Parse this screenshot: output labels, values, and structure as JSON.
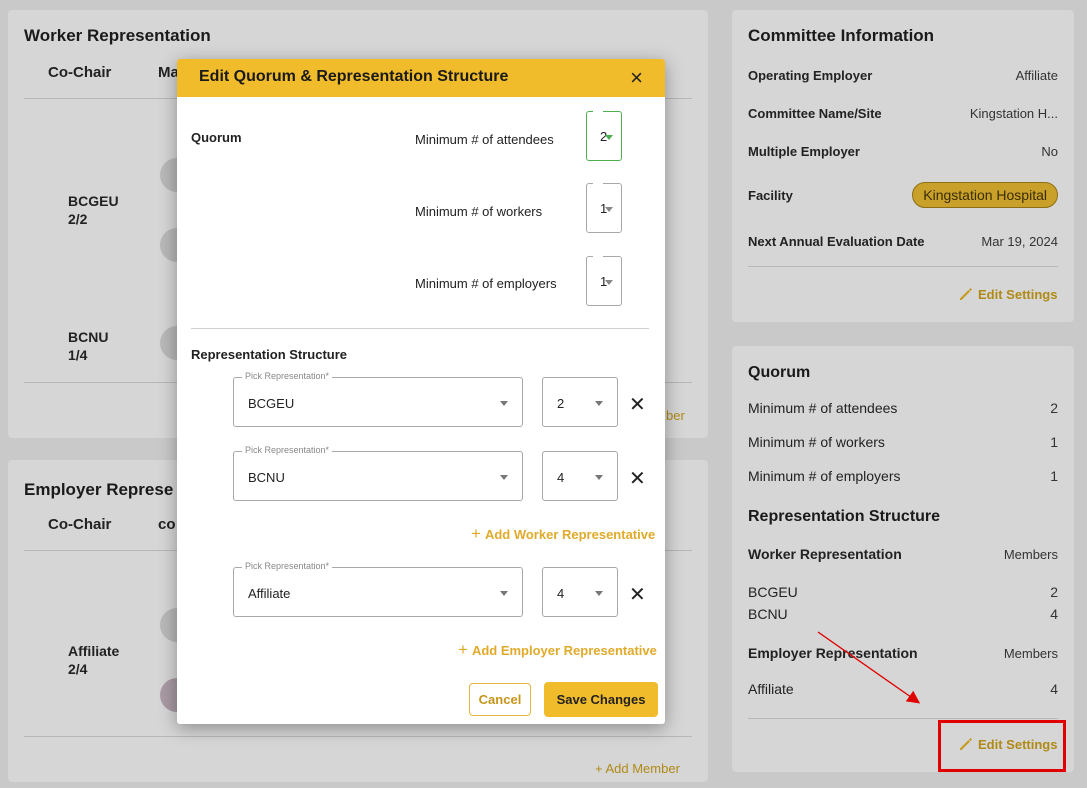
{
  "worker_card": {
    "title": "Worker Representation",
    "col_cochair": "Co-Chair",
    "col_members_partial": "Ma",
    "reps": [
      {
        "name": "BCGEU",
        "count": "2/2"
      },
      {
        "name": "BCNU",
        "count": "1/4"
      }
    ],
    "add_member_partial": "ber"
  },
  "employer_card": {
    "title": "Employer Represe",
    "col_cochair": "Co-Chair",
    "col_members_partial": "co",
    "reps": [
      {
        "name": "Affiliate",
        "count": "2/4"
      }
    ],
    "add_member": "+ Add Member"
  },
  "committee": {
    "title": "Committee Information",
    "rows": [
      {
        "key": "Operating Employer",
        "value": "Affiliate"
      },
      {
        "key": "Committee Name/Site",
        "value": "Kingstation H..."
      },
      {
        "key": "Multiple Employer",
        "value": "No"
      },
      {
        "key": "Facility",
        "value": "Kingstation Hospital"
      },
      {
        "key": "Next Annual Evaluation Date",
        "value": "Mar 19, 2024"
      }
    ],
    "edit_label": "Edit Settings"
  },
  "quorum_card": {
    "title": "Quorum",
    "rows": [
      {
        "key": "Minimum # of attendees",
        "value": "2"
      },
      {
        "key": "Minimum # of workers",
        "value": "1"
      },
      {
        "key": "Minimum # of employers",
        "value": "1"
      }
    ],
    "rep_structure_title": "Representation Structure",
    "worker_header": {
      "key": "Worker Representation",
      "value": "Members"
    },
    "worker_rows": [
      {
        "key": "BCGEU",
        "value": "2"
      },
      {
        "key": "BCNU",
        "value": "4"
      }
    ],
    "employer_header": {
      "key": "Employer Representation",
      "value": "Members"
    },
    "employer_rows": [
      {
        "key": "Affiliate",
        "value": "4"
      }
    ],
    "edit_label": "Edit Settings"
  },
  "modal": {
    "title": "Edit Quorum & Representation Structure",
    "close_icon": "×",
    "quorum_label": "Quorum",
    "min_attendees_label": "Minimum # of attendees",
    "min_attendees_value": "2",
    "min_workers_label": "Minimum # of workers",
    "min_workers_value": "1",
    "min_employers_label": "Minimum # of employers",
    "min_employers_value": "1",
    "rep_structure_label": "Representation Structure",
    "pick_legend": "Pick Representation*",
    "rows": [
      {
        "rep": "BCGEU",
        "count": "2"
      },
      {
        "rep": "BCNU",
        "count": "4"
      },
      {
        "rep": "Affiliate",
        "count": "4"
      }
    ],
    "remove_icon": "✕",
    "add_worker": "Add Worker Representative",
    "add_employer": "Add Employer Representative",
    "plus": "+",
    "cancel_label": "Cancel",
    "save_label": "Save Changes"
  },
  "colors": {
    "accent": "#f1bc2c",
    "highlight": "#e00000"
  }
}
